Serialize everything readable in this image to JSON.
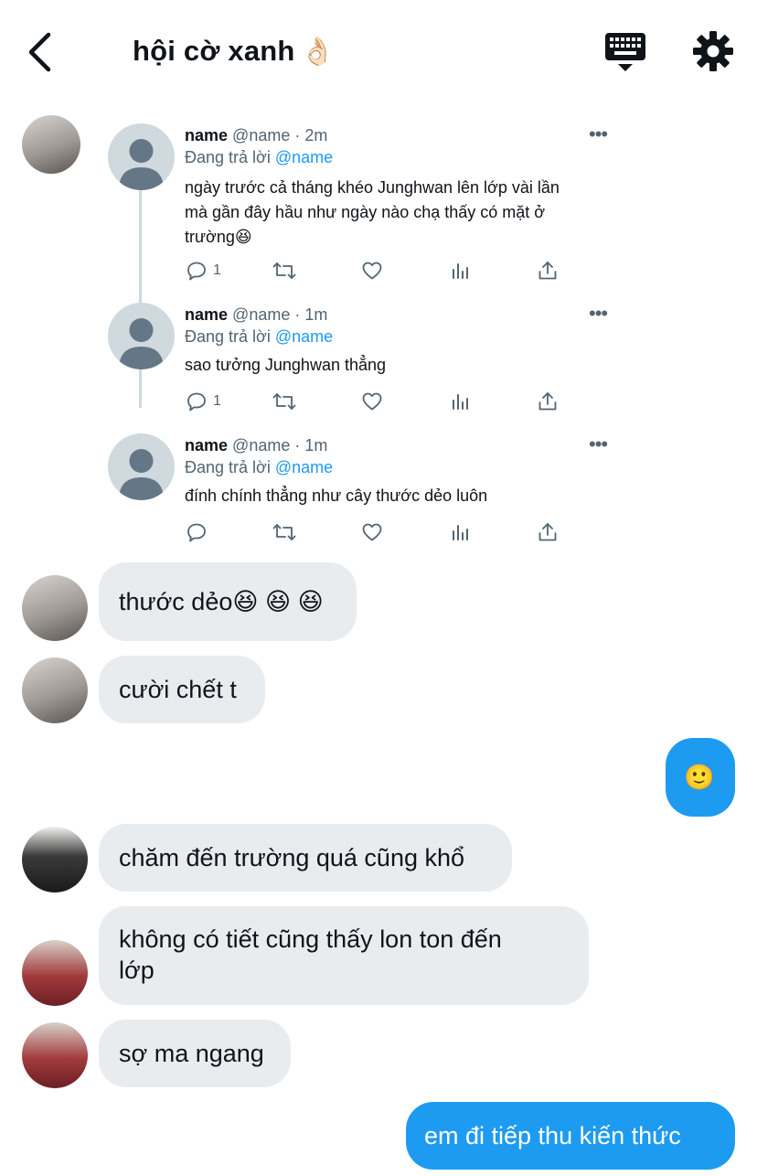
{
  "header": {
    "title": "hội cờ xanh",
    "title_emoji": "👌🏻",
    "icons": {
      "back": "chevron-left-icon",
      "keyboard": "keyboard-icon",
      "settings": "gear-icon"
    }
  },
  "quoted_tweets": [
    {
      "name": "name",
      "handle": "@name",
      "time": "2m",
      "replying_label": "Đang trả lời",
      "replying_to": "@name",
      "text_lines": [
        "ngày trước cả tháng khéo Junghwan lên lớp vài lần",
        "mà gần đây hầu như ngày nào chạ thấy có mặt ở",
        "trường😆"
      ],
      "reply_count": "1"
    },
    {
      "name": "name",
      "handle": "@name",
      "time": "1m",
      "replying_label": "Đang trả lời",
      "replying_to": "@name",
      "text_lines": [
        "sao tưởng Junghwan thẳng"
      ],
      "reply_count": "1"
    },
    {
      "name": "name",
      "handle": "@name",
      "time": "1m",
      "replying_label": "Đang trả lời",
      "replying_to": "@name",
      "text_lines": [
        "đính chính thẳng như cây thước dẻo luôn"
      ],
      "reply_count": ""
    }
  ],
  "messages": [
    {
      "side": "left",
      "text": "thước dẻo😆 😆 😆"
    },
    {
      "side": "left",
      "text": "cười chết t"
    },
    {
      "side": "right",
      "text": "🙂"
    },
    {
      "side": "left",
      "text": "chăm đến trường quá cũng khổ"
    },
    {
      "side": "left",
      "text_lines": [
        "không có tiết cũng thấy lon ton đến",
        "lớp"
      ]
    },
    {
      "side": "left",
      "text": "sợ ma ngang"
    },
    {
      "side": "right",
      "text": "em đi tiếp thu kiến thức"
    }
  ],
  "colors": {
    "accent": "#1d9bf0",
    "bubble_left": "#e9ecef",
    "muted": "#536471",
    "text": "#0f1419"
  }
}
